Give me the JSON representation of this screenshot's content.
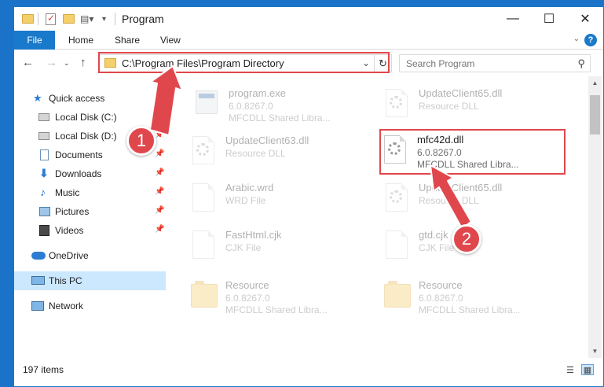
{
  "window": {
    "title": "Program"
  },
  "ribbon": {
    "file": "File",
    "tabs": [
      "Home",
      "Share",
      "View"
    ]
  },
  "address": {
    "path": "C:\\Program Files\\Program Directory"
  },
  "search": {
    "placeholder": "Search Program"
  },
  "nav": {
    "items": [
      {
        "label": "Quick access",
        "icon": "star-icon"
      },
      {
        "label": "Local Disk (C:)",
        "icon": "drive-icon"
      },
      {
        "label": "Local Disk (D:)",
        "icon": "drive-icon"
      },
      {
        "label": "Documents",
        "icon": "documents-icon"
      },
      {
        "label": "Downloads",
        "icon": "download-icon"
      },
      {
        "label": "Music",
        "icon": "music-icon"
      },
      {
        "label": "Pictures",
        "icon": "pictures-icon"
      },
      {
        "label": "Videos",
        "icon": "videos-icon"
      },
      {
        "label": "OneDrive",
        "icon": "cloud-icon"
      },
      {
        "label": "This PC",
        "icon": "computer-icon"
      },
      {
        "label": "Network",
        "icon": "network-icon"
      }
    ]
  },
  "files": [
    {
      "name": "program.exe",
      "line2": "6.0.8267.0",
      "line3": "MFCDLL Shared Libra..."
    },
    {
      "name": "UpdateClient65.dll",
      "line2": "Resource DLL",
      "line3": ""
    },
    {
      "name": "UpdateClient63.dll",
      "line2": "Resource DLL",
      "line3": ""
    },
    {
      "name": "mfc42d.dll",
      "line2": "6.0.8267.0",
      "line3": "MFCDLL Shared Libra..."
    },
    {
      "name": "Arabic.wrd",
      "line2": "WRD File",
      "line3": ""
    },
    {
      "name": "UpdateClient65.dll",
      "line2": "Resource DLL",
      "line3": ""
    },
    {
      "name": "FastHtml.cjk",
      "line2": "CJK File",
      "line3": ""
    },
    {
      "name": "gtd.cjk",
      "line2": "CJK File",
      "line3": ""
    },
    {
      "name": "Resource",
      "line2": "6.0.8267.0",
      "line3": "MFCDLL Shared Libra..."
    },
    {
      "name": "Resource",
      "line2": "6.0.8267.0",
      "line3": "MFCDLL Shared Libra..."
    }
  ],
  "status": {
    "count": "197 items"
  },
  "annotations": {
    "step1": "1",
    "step2": "2"
  },
  "colors": {
    "accent": "#1979ca",
    "highlight": "#e0474c",
    "selection": "#cce8ff"
  }
}
